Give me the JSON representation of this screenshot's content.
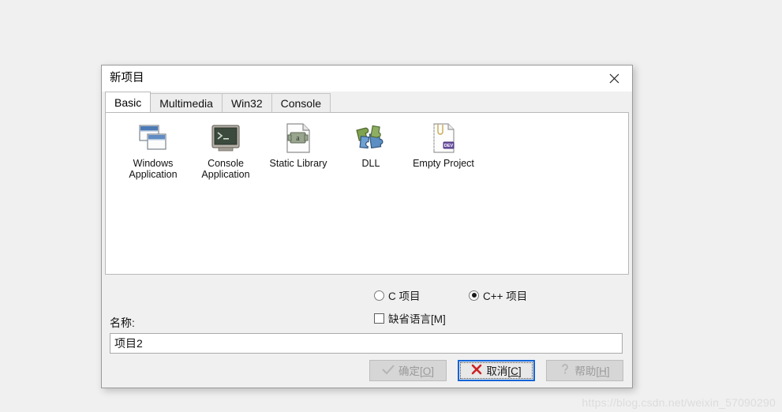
{
  "dialog": {
    "title": "新项目",
    "close_icon": "close-icon"
  },
  "tabs": [
    {
      "label": "Basic",
      "active": true
    },
    {
      "label": "Multimedia",
      "active": false
    },
    {
      "label": "Win32",
      "active": false
    },
    {
      "label": "Console",
      "active": false
    }
  ],
  "project_types": [
    {
      "label": "Windows\nApplication",
      "icon": "windows-application-icon"
    },
    {
      "label": "Console\nApplication",
      "icon": "console-application-icon"
    },
    {
      "label": "Static Library",
      "icon": "static-library-icon"
    },
    {
      "label": "DLL",
      "icon": "dll-puzzle-icon"
    },
    {
      "label": "Empty Project",
      "icon": "empty-project-icon"
    }
  ],
  "options": {
    "radio_c": {
      "label": "C 项目",
      "selected": false
    },
    "radio_cpp": {
      "label": "C++ 项目",
      "selected": true
    },
    "checkbox_default_lang": {
      "label": "缺省语言[M]",
      "checked": false
    }
  },
  "name_field": {
    "label": "名称:",
    "value": "项目2",
    "placeholder": ""
  },
  "buttons": {
    "ok": {
      "text": "确定[",
      "accel": "O",
      "text_end": "]",
      "enabled": false,
      "icon": "check-icon"
    },
    "cancel": {
      "text": "取消[",
      "accel": "C",
      "text_end": "]",
      "enabled": true,
      "icon": "cross-icon"
    },
    "help": {
      "text": "帮助[",
      "accel": "H",
      "text_end": "]",
      "enabled": false,
      "icon": "question-icon"
    }
  },
  "watermark": "https://blog.csdn.net/weixin_57090290",
  "colors": {
    "accent_blue": "#1565d8",
    "cancel_red": "#cc2222",
    "dialog_bg": "#f0f0f0",
    "panel_bg": "#ffffff"
  }
}
